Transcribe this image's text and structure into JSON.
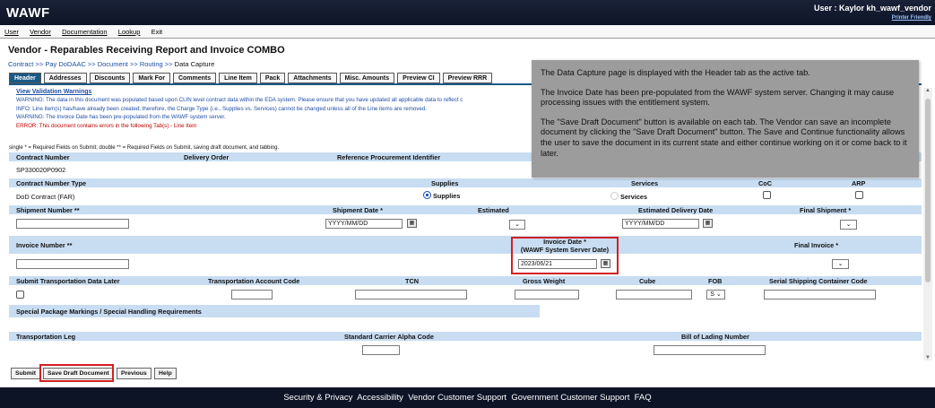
{
  "app": {
    "logo": "WAWF",
    "user": "User : Kaylor kh_wawf_vendor",
    "printer_friendly": "Printer Friendly"
  },
  "menu": [
    "User",
    "Vendor",
    "Documentation",
    "Lookup",
    "Exit"
  ],
  "page_title": "Vendor - Reparables Receiving Report and Invoice COMBO",
  "breadcrumb": {
    "items": [
      "Contract",
      "Pay DoDAAC",
      "Document",
      "Routing"
    ],
    "current": "Data Capture",
    "sep": ">>"
  },
  "tabs": [
    "Header",
    "Addresses",
    "Discounts",
    "Mark For",
    "Comments",
    "Line Item",
    "Pack",
    "Attachments",
    "Misc. Amounts",
    "Preview CI",
    "Preview RRR"
  ],
  "messages": {
    "validation_link": "View Validation Warnings",
    "warning1": "WARNING: The data in this document was populated based upon CLIN level contract data within the EDA system. Please ensure that you have updated all applicable data to reflect c",
    "info1": "INFO: Line item(s) has/have already been created; therefore, the Charge Type (i.e., Supplies vs. Services) cannot be changed unless all of the Line items are removed.",
    "warning2": "WARNING: The Invoice Date has been pre-populated from the WAWF system server.",
    "error1": "ERROR: This document contains errors in the following Tab(s) - Line Item"
  },
  "legend": "single * = Required Fields on Submit; double ** = Required Fields on Submit, saving draft document, and tabbing.",
  "form": {
    "contract_number_label": "Contract Number",
    "delivery_order_label": "Delivery Order",
    "ref_proc_label": "Reference Procurement Identifier",
    "contract_number_value": "SP330020P0902",
    "contract_type_label": "Contract Number Type",
    "contract_type_value": "DoD Contract (FAR)",
    "supplies_label": "Supplies",
    "services_label": "Services",
    "coc_label": "CoC",
    "arp_label": "ARP",
    "supplies_option": "Supplies",
    "services_option": "Services",
    "shipment_number_label": "Shipment Number **",
    "shipment_date_label": "Shipment Date *",
    "estimated_label": "Estimated",
    "est_delivery_label": "Estimated Delivery Date",
    "final_shipment_label": "Final Shipment *",
    "date_placeholder": "YYYY/MM/DD",
    "invoice_number_label": "Invoice Number **",
    "invoice_date_label": "Invoice Date *",
    "invoice_date_sub": "(WAWF System Server Date)",
    "invoice_date_value": "2023/06/21",
    "final_invoice_label": "Final Invoice *",
    "submit_transport_label": "Submit Transportation Data Later",
    "transport_account_label": "Transportation Account Code",
    "tcn_label": "TCN",
    "gross_weight_label": "Gross Weight",
    "cube_label": "Cube",
    "fob_label": "FOB",
    "fob_value": "S",
    "serial_container_label": "Serial Shipping Container Code",
    "special_package_label": "Special Package Markings / Special Handling Requirements",
    "transport_leg_label": "Transportation Leg",
    "carrier_alpha_label": "Standard Carrier Alpha Code",
    "bill_of_lading_label": "Bill of Lading Number"
  },
  "buttons": {
    "submit": "Submit",
    "save_draft": "Save Draft Document",
    "previous": "Previous",
    "help": "Help"
  },
  "footer": [
    "Security & Privacy",
    "Accessibility",
    "Vendor Customer Support",
    "Government Customer Support",
    "FAQ"
  ],
  "callout": {
    "p1": "The Data Capture page is displayed with the Header tab as the active tab.",
    "p2": "The Invoice Date has been pre-populated from the WAWF system server. Changing it may cause processing issues with the entitlement system.",
    "p3": "The \"Save Draft Document\" button is available on each tab. The Vendor can save an incomplete document by clicking the \"Save Draft Document\" button. The Save and Continue functionality allows the user to save the document in its current state and either continue working on it or come back to it later."
  },
  "icons": {
    "calendar": "calendar-icon",
    "dropdown": "chevron-down-icon"
  },
  "colors": {
    "header_blue": "#c8ddf2",
    "active_tab": "#1a5a86",
    "highlight_red": "#d32020",
    "topbar": "#0d1426"
  }
}
